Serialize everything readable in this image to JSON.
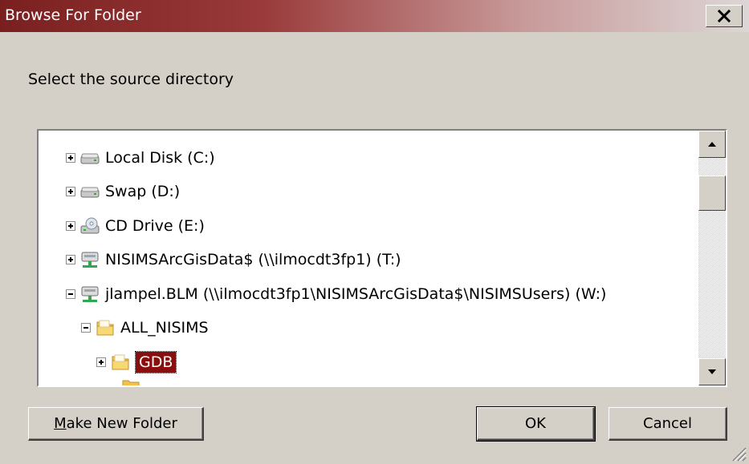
{
  "window": {
    "title": "Browse For Folder",
    "close_label": "X"
  },
  "instruction": "Select the source directory",
  "tree": {
    "items": [
      {
        "label": "Local Disk (C:)",
        "icon": "hard-drive-icon",
        "expander": "+"
      },
      {
        "label": "Swap (D:)",
        "icon": "hard-drive-icon",
        "expander": "+"
      },
      {
        "label": "CD Drive (E:)",
        "icon": "cd-drive-icon",
        "expander": "+"
      },
      {
        "label": "NISIMSArcGisData$ (\\\\ilmocdt3fp1) (T:)",
        "icon": "network-drive-icon",
        "expander": "+"
      },
      {
        "label": "jlampel.BLM (\\\\ilmocdt3fp1\\NISIMSArcGisData$\\NISIMSUsers) (W:)",
        "icon": "network-drive-icon",
        "expander": "-"
      },
      {
        "label": "ALL_NISIMS",
        "icon": "folder-icon",
        "expander": "-"
      },
      {
        "label": "GDB",
        "icon": "folder-icon",
        "expander": "+",
        "selected": true
      }
    ]
  },
  "buttons": {
    "make_new_folder": "Make New Folder",
    "make_new_folder_mnemonic": "M",
    "make_new_folder_rest": "ake New Folder",
    "ok": "OK",
    "cancel": "Cancel"
  },
  "colors": {
    "titlebar_start": "#7a1f1f",
    "selection": "#8b0e0e",
    "dialog_bg": "#d4d0c8"
  }
}
